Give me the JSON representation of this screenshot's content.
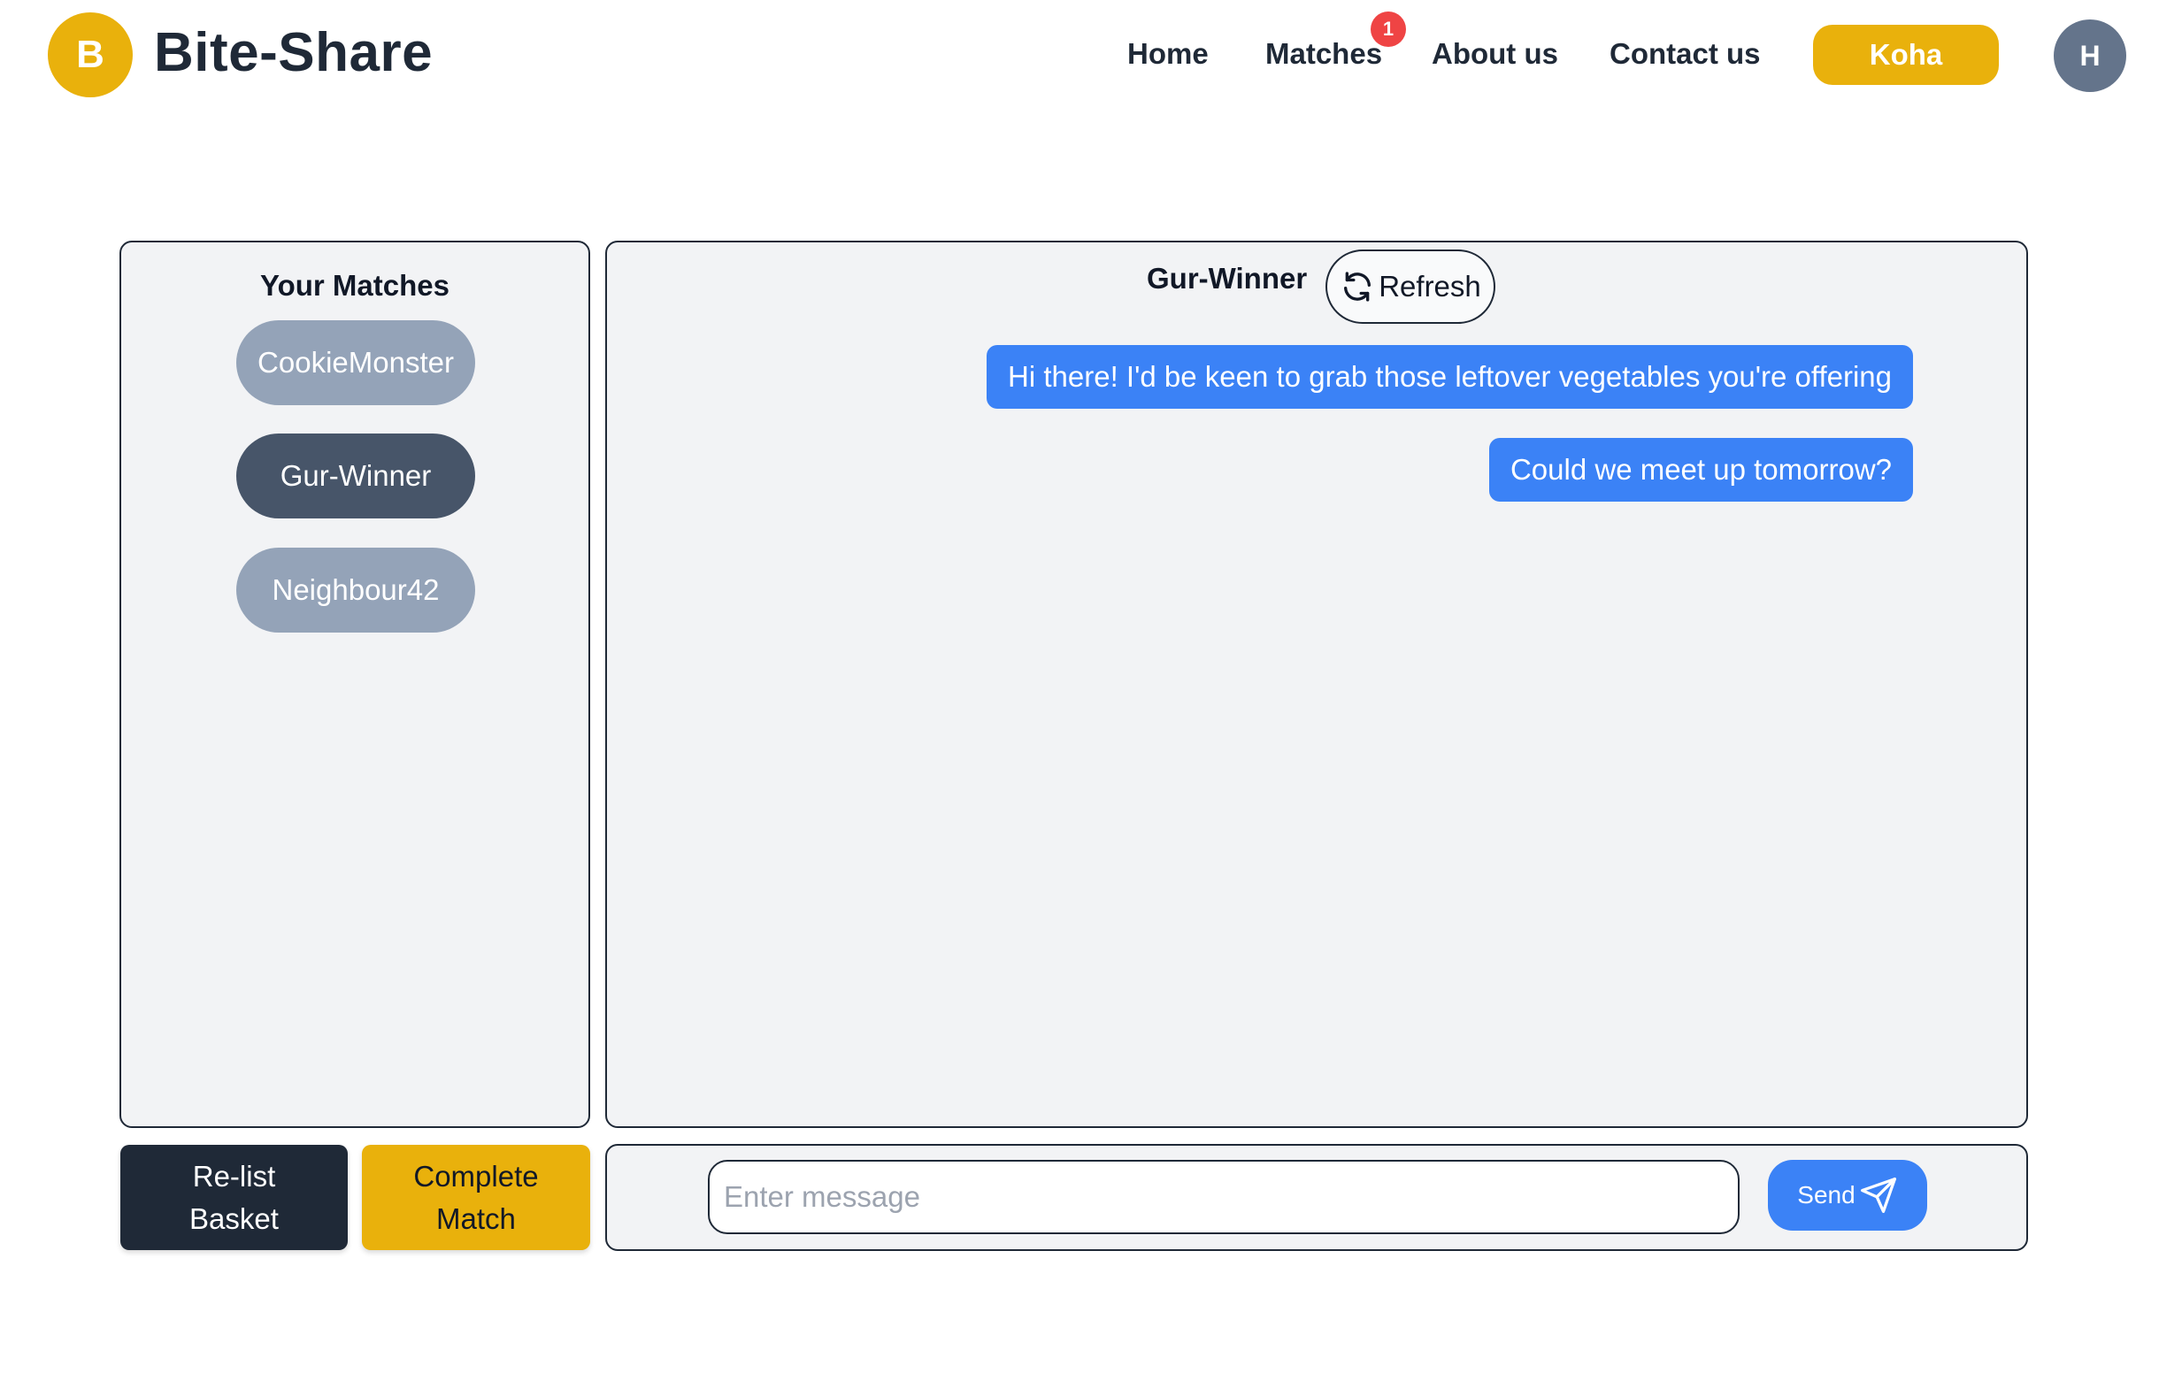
{
  "header": {
    "logo_letter": "B",
    "brand": "Bite-Share",
    "nav": {
      "home": "Home",
      "matches": "Matches",
      "matches_badge": "1",
      "about": "About us",
      "contact": "Contact us",
      "koha": "Koha"
    },
    "avatar_initial": "H"
  },
  "matches_panel": {
    "title": "Your Matches",
    "items": [
      {
        "label": "CookieMonster",
        "active": false
      },
      {
        "label": "Gur-Winner",
        "active": true
      },
      {
        "label": "Neighbour42",
        "active": false
      }
    ]
  },
  "actions": {
    "relist_line1": "Re-list",
    "relist_line2": "Basket",
    "complete_line1": "Complete",
    "complete_line2": "Match"
  },
  "chat": {
    "title": "Gur-Winner",
    "refresh_label": "Refresh",
    "messages": [
      "Hi there! I'd be keen to grab those leftover vegetables you're offering",
      "Could we meet up tomorrow?"
    ],
    "input_placeholder": "Enter message",
    "send_label": "Send"
  },
  "colors": {
    "brand_yellow": "#e9b10c",
    "message_blue": "#3b82f6",
    "active_pill": "#475569",
    "inactive_pill": "#94a3b8",
    "badge_red": "#ef4444"
  }
}
